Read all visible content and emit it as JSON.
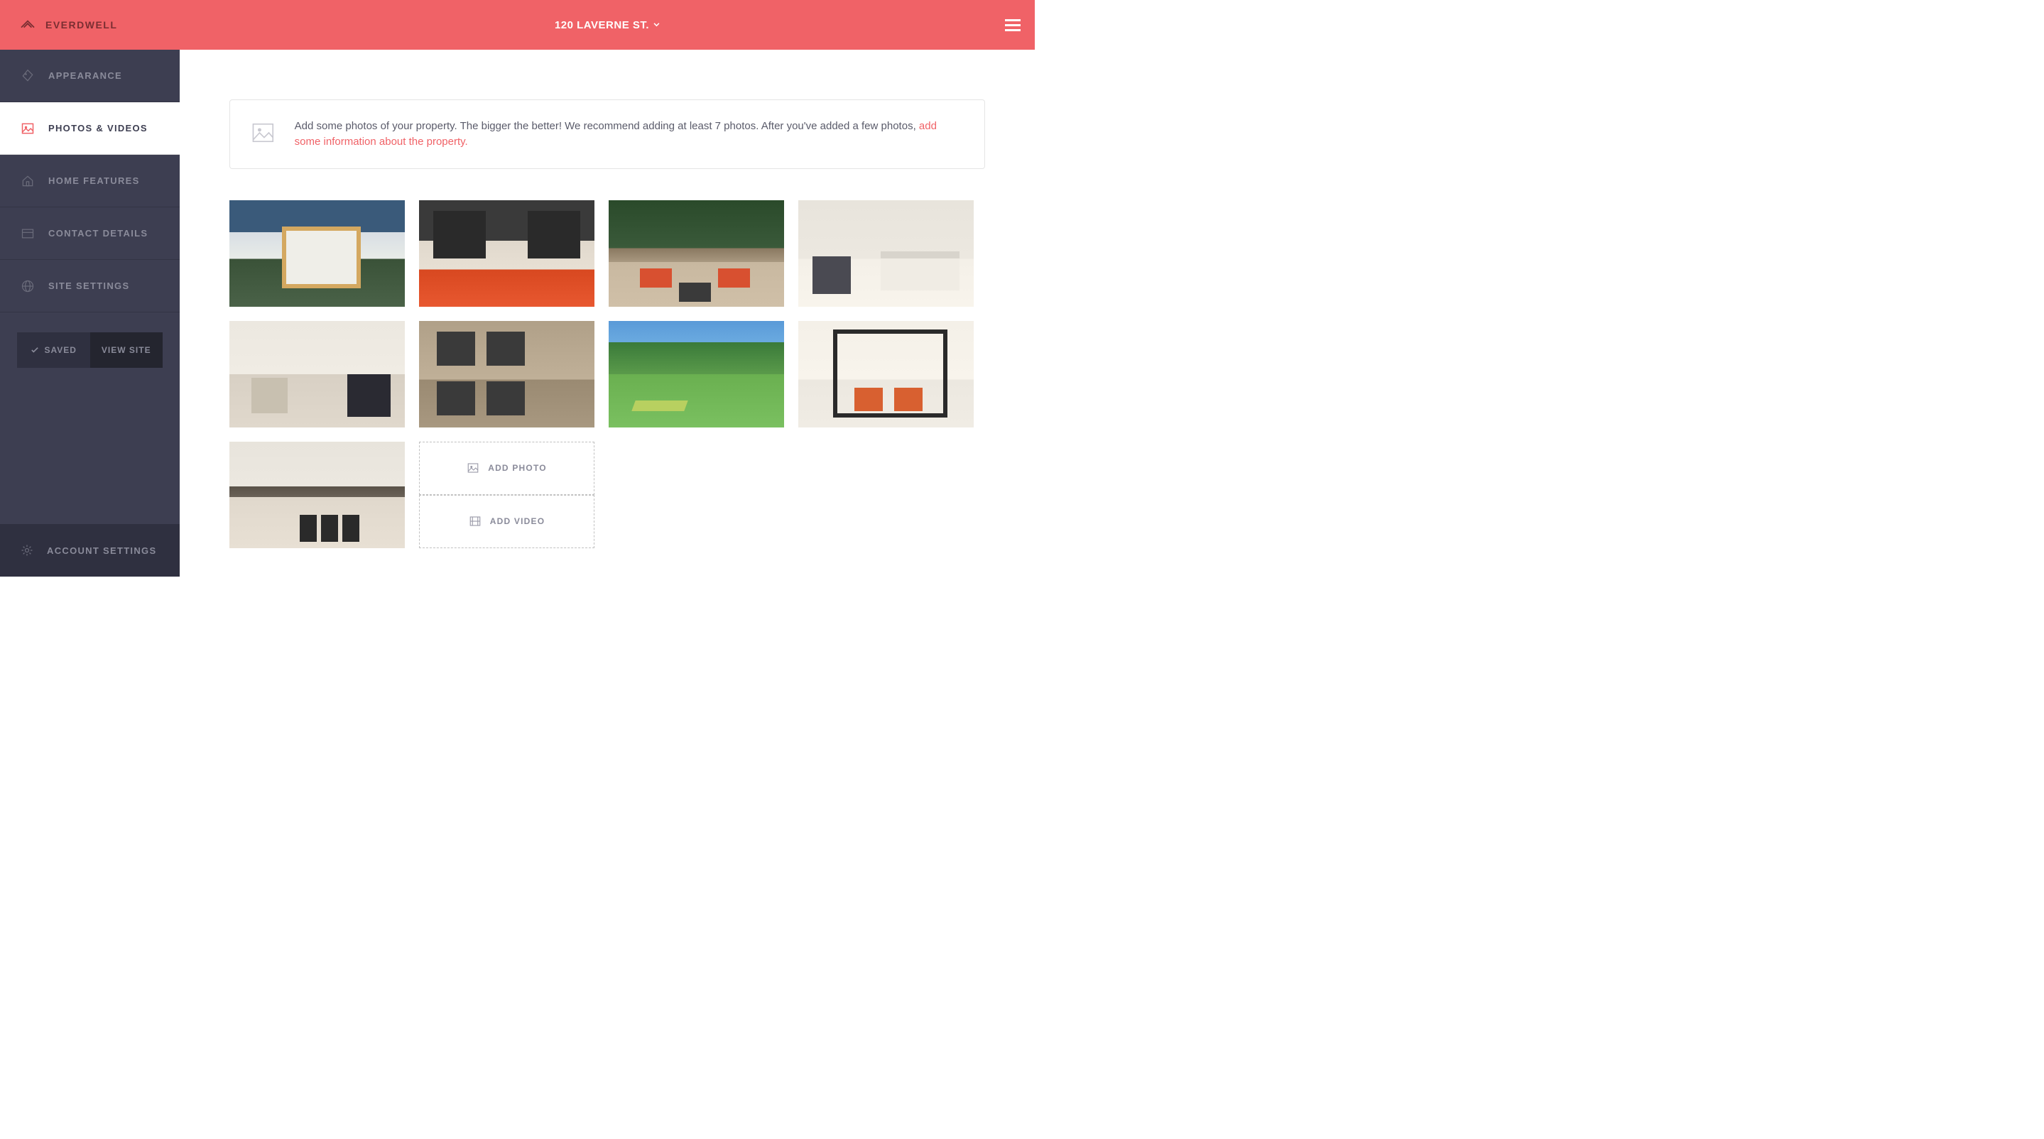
{
  "brand": {
    "name": "EVERDWELL"
  },
  "header": {
    "address": "120 LAVERNE ST."
  },
  "sidebar": {
    "items": [
      {
        "label": "APPEARANCE"
      },
      {
        "label": "PHOTOS & VIDEOS"
      },
      {
        "label": "HOME FEATURES"
      },
      {
        "label": "CONTACT DETAILS"
      },
      {
        "label": "SITE SETTINGS"
      }
    ],
    "active_index": 1,
    "saved_label": "SAVED",
    "view_site_label": "VIEW SITE",
    "account_label": "ACCOUNT SETTINGS"
  },
  "notice": {
    "text": "Add some photos of your property. The bigger the better! We recommend adding at least 7 photos. After you've added a few photos, ",
    "link": "add some information about the property."
  },
  "add": {
    "photo_label": "ADD PHOTO",
    "video_label": "ADD VIDEO"
  },
  "photos": {
    "count": 9
  }
}
